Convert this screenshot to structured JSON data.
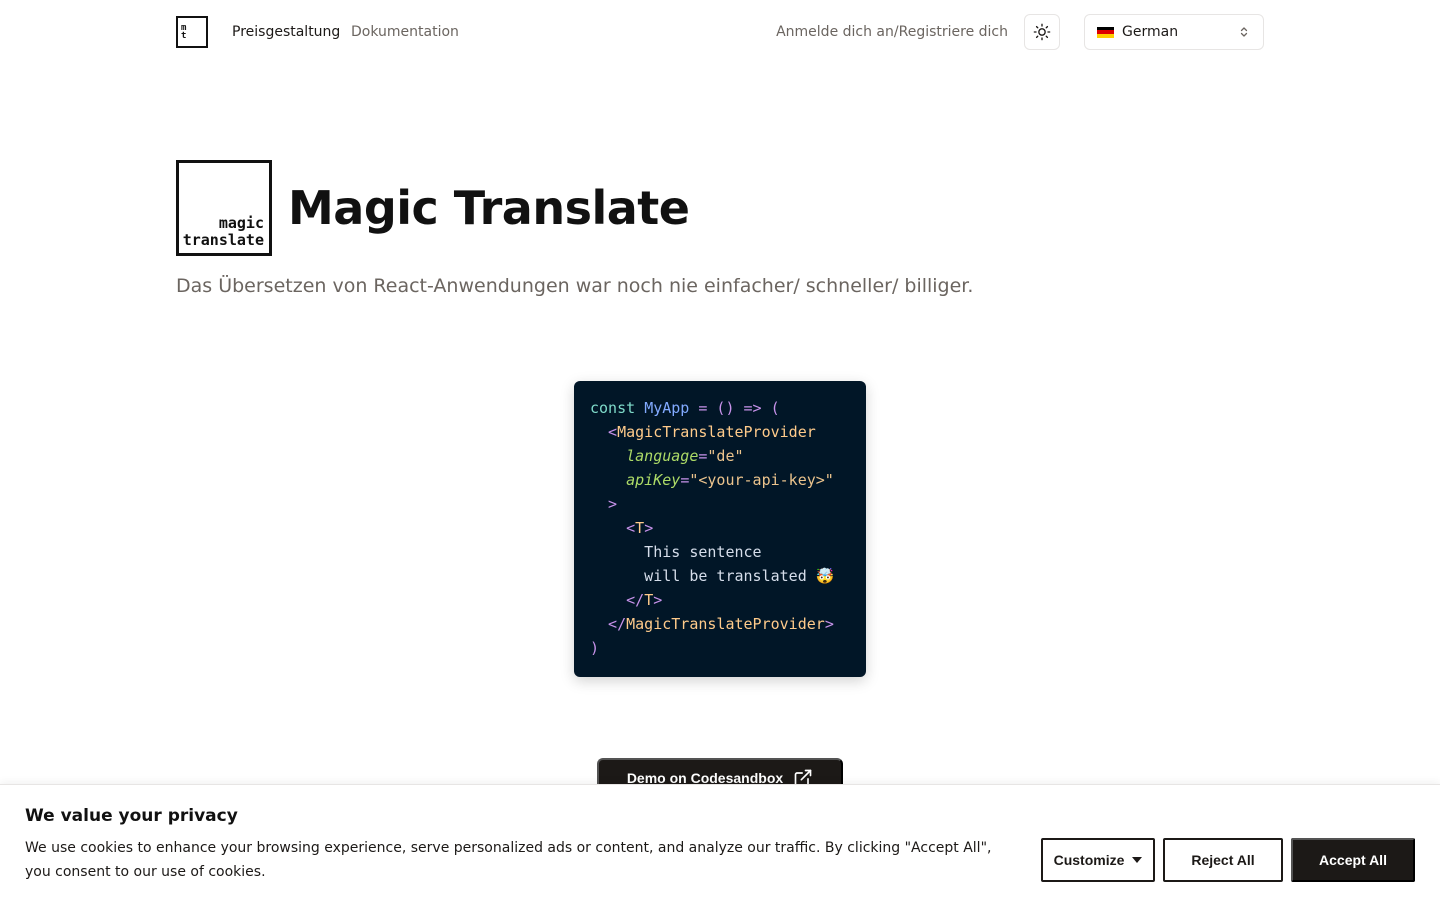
{
  "nav": {
    "logo_lines": [
      "m",
      "t"
    ],
    "links": [
      {
        "label": "Preisgestaltung"
      },
      {
        "label": "Dokumentation"
      }
    ],
    "login_label": "Anmelde dich an/Registriere dich",
    "theme_icon": "sun-icon",
    "language": {
      "selected": "German",
      "flag": "de-flag"
    }
  },
  "hero": {
    "logo_lines": [
      "magic",
      "translate"
    ],
    "title": "Magic Translate",
    "subtitle": "Das Übersetzen von React-Anwendungen war noch nie einfacher/ schneller/ billiger."
  },
  "code": {
    "lines": [
      [
        {
          "t": "const ",
          "c": "kw"
        },
        {
          "t": "MyApp",
          "c": "fn"
        },
        {
          "t": " = () => (",
          "c": "op"
        }
      ],
      [
        {
          "t": "  <",
          "c": "op"
        },
        {
          "t": "MagicTranslateProvider",
          "c": "tag"
        }
      ],
      [
        {
          "t": "    ",
          "c": "txt"
        },
        {
          "t": "language",
          "c": "attr"
        },
        {
          "t": "=",
          "c": "op"
        },
        {
          "t": "\"de\"",
          "c": "str"
        }
      ],
      [
        {
          "t": "    ",
          "c": "txt"
        },
        {
          "t": "apiKey",
          "c": "attr"
        },
        {
          "t": "=",
          "c": "op"
        },
        {
          "t": "\"<your-api-key>\"",
          "c": "str"
        }
      ],
      [
        {
          "t": "  >",
          "c": "op"
        }
      ],
      [
        {
          "t": "    <",
          "c": "op"
        },
        {
          "t": "T",
          "c": "tag"
        },
        {
          "t": ">",
          "c": "op"
        }
      ],
      [
        {
          "t": "      This sentence",
          "c": "txt"
        }
      ],
      [
        {
          "t": "      will be translated 🤯",
          "c": "txt"
        }
      ],
      [
        {
          "t": "    </",
          "c": "op"
        },
        {
          "t": "T",
          "c": "tag"
        },
        {
          "t": ">",
          "c": "op"
        }
      ],
      [
        {
          "t": "  </",
          "c": "op"
        },
        {
          "t": "MagicTranslateProvider",
          "c": "tag"
        },
        {
          "t": ">",
          "c": "op"
        }
      ],
      [
        {
          "t": ")",
          "c": "op"
        }
      ]
    ]
  },
  "demo": {
    "label": "Demo on Codesandbox",
    "icon": "external-link-icon"
  },
  "cookie": {
    "title": "We value your privacy",
    "text": "We use cookies to enhance your browsing experience, serve personalized ads or content, and analyze our traffic. By clicking \"Accept All\", you consent to our use of cookies.",
    "customize_label": "Customize",
    "reject_label": "Reject All",
    "accept_label": "Accept All"
  },
  "colors": {
    "code_bg": "#011627",
    "primary": "#1c1917",
    "muted_text": "#6b6560"
  }
}
